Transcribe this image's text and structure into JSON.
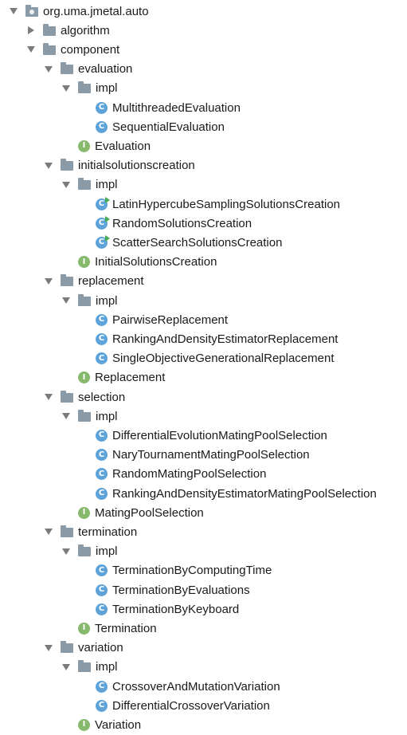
{
  "tree": [
    {
      "label": "org.uma.jmetal.auto",
      "depth": 0,
      "expand": "down",
      "icon": "package-folder-icon",
      "kind": "pkg"
    },
    {
      "label": "algorithm",
      "depth": 1,
      "expand": "right",
      "icon": "folder-icon",
      "kind": "folder"
    },
    {
      "label": "component",
      "depth": 1,
      "expand": "down",
      "icon": "folder-icon",
      "kind": "folder"
    },
    {
      "label": "evaluation",
      "depth": 2,
      "expand": "down",
      "icon": "folder-icon",
      "kind": "folder"
    },
    {
      "label": "impl",
      "depth": 3,
      "expand": "down",
      "icon": "folder-icon",
      "kind": "folder"
    },
    {
      "label": "MultithreadedEvaluation",
      "depth": 4,
      "expand": "none",
      "icon": "class-icon",
      "kind": "class"
    },
    {
      "label": "SequentialEvaluation",
      "depth": 4,
      "expand": "none",
      "icon": "class-icon",
      "kind": "class"
    },
    {
      "label": "Evaluation",
      "depth": 3,
      "expand": "none",
      "icon": "interface-icon",
      "kind": "iface"
    },
    {
      "label": "initialsolutionscreation",
      "depth": 2,
      "expand": "down",
      "icon": "folder-icon",
      "kind": "folder"
    },
    {
      "label": "impl",
      "depth": 3,
      "expand": "down",
      "icon": "folder-icon",
      "kind": "folder"
    },
    {
      "label": "LatinHypercubeSamplingSolutionsCreation",
      "depth": 4,
      "expand": "none",
      "icon": "runnable-class-icon",
      "kind": "runclass"
    },
    {
      "label": "RandomSolutionsCreation",
      "depth": 4,
      "expand": "none",
      "icon": "runnable-class-icon",
      "kind": "runclass"
    },
    {
      "label": "ScatterSearchSolutionsCreation",
      "depth": 4,
      "expand": "none",
      "icon": "runnable-class-icon",
      "kind": "runclass"
    },
    {
      "label": "InitialSolutionsCreation",
      "depth": 3,
      "expand": "none",
      "icon": "interface-icon",
      "kind": "iface"
    },
    {
      "label": "replacement",
      "depth": 2,
      "expand": "down",
      "icon": "folder-icon",
      "kind": "folder"
    },
    {
      "label": "impl",
      "depth": 3,
      "expand": "down",
      "icon": "folder-icon",
      "kind": "folder"
    },
    {
      "label": "PairwiseReplacement",
      "depth": 4,
      "expand": "none",
      "icon": "class-icon",
      "kind": "class"
    },
    {
      "label": "RankingAndDensityEstimatorReplacement",
      "depth": 4,
      "expand": "none",
      "icon": "class-icon",
      "kind": "class"
    },
    {
      "label": "SingleObjectiveGenerationalReplacement",
      "depth": 4,
      "expand": "none",
      "icon": "class-icon",
      "kind": "class"
    },
    {
      "label": "Replacement",
      "depth": 3,
      "expand": "none",
      "icon": "interface-icon",
      "kind": "iface"
    },
    {
      "label": "selection",
      "depth": 2,
      "expand": "down",
      "icon": "folder-icon",
      "kind": "folder"
    },
    {
      "label": "impl",
      "depth": 3,
      "expand": "down",
      "icon": "folder-icon",
      "kind": "folder"
    },
    {
      "label": "DifferentialEvolutionMatingPoolSelection",
      "depth": 4,
      "expand": "none",
      "icon": "class-icon",
      "kind": "class"
    },
    {
      "label": "NaryTournamentMatingPoolSelection",
      "depth": 4,
      "expand": "none",
      "icon": "class-icon",
      "kind": "class"
    },
    {
      "label": "RandomMatingPoolSelection",
      "depth": 4,
      "expand": "none",
      "icon": "class-icon",
      "kind": "class"
    },
    {
      "label": "RankingAndDensityEstimatorMatingPoolSelection",
      "depth": 4,
      "expand": "none",
      "icon": "class-icon",
      "kind": "class"
    },
    {
      "label": "MatingPoolSelection",
      "depth": 3,
      "expand": "none",
      "icon": "interface-icon",
      "kind": "iface"
    },
    {
      "label": "termination",
      "depth": 2,
      "expand": "down",
      "icon": "folder-icon",
      "kind": "folder"
    },
    {
      "label": "impl",
      "depth": 3,
      "expand": "down",
      "icon": "folder-icon",
      "kind": "folder"
    },
    {
      "label": "TerminationByComputingTime",
      "depth": 4,
      "expand": "none",
      "icon": "class-icon",
      "kind": "class"
    },
    {
      "label": "TerminationByEvaluations",
      "depth": 4,
      "expand": "none",
      "icon": "class-icon",
      "kind": "class"
    },
    {
      "label": "TerminationByKeyboard",
      "depth": 4,
      "expand": "none",
      "icon": "class-icon",
      "kind": "class"
    },
    {
      "label": "Termination",
      "depth": 3,
      "expand": "none",
      "icon": "interface-icon",
      "kind": "iface"
    },
    {
      "label": "variation",
      "depth": 2,
      "expand": "down",
      "icon": "folder-icon",
      "kind": "folder"
    },
    {
      "label": "impl",
      "depth": 3,
      "expand": "down",
      "icon": "folder-icon",
      "kind": "folder"
    },
    {
      "label": "CrossoverAndMutationVariation",
      "depth": 4,
      "expand": "none",
      "icon": "class-icon",
      "kind": "class"
    },
    {
      "label": "DifferentialCrossoverVariation",
      "depth": 4,
      "expand": "none",
      "icon": "class-icon",
      "kind": "class"
    },
    {
      "label": "Variation",
      "depth": 3,
      "expand": "none",
      "icon": "interface-icon",
      "kind": "iface"
    }
  ],
  "glyphs": {
    "class": "C",
    "iface": "I"
  },
  "colors": {
    "class": "#5da3d9",
    "interface": "#86b96c",
    "folder": "#8a9aa6",
    "run_marker": "#3fae4b"
  }
}
